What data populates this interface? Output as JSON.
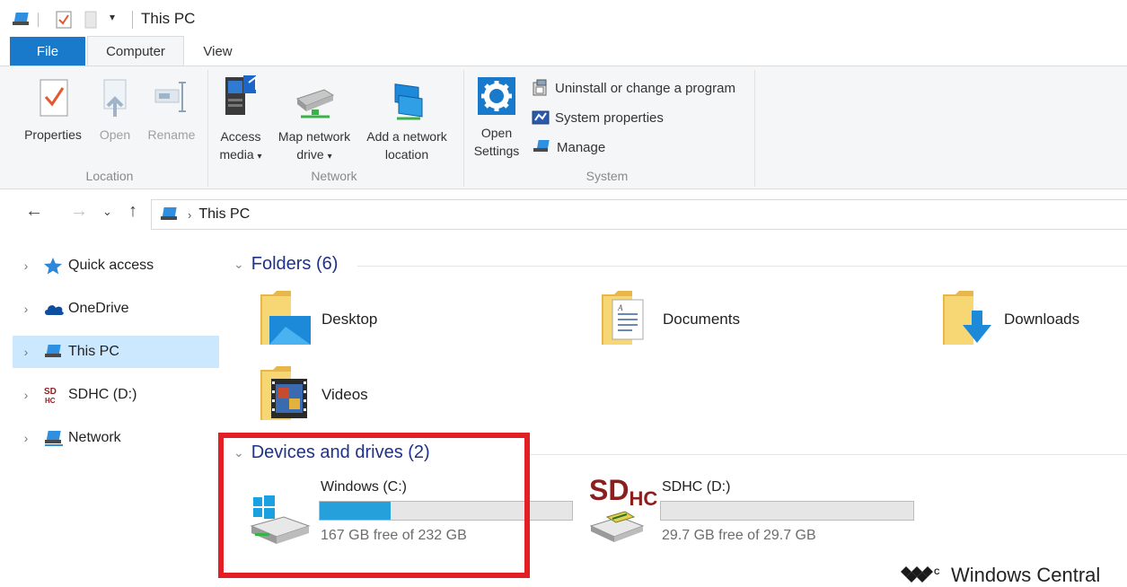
{
  "window": {
    "title": "This PC"
  },
  "tabs": [
    {
      "label": "File"
    },
    {
      "label": "Computer"
    },
    {
      "label": "View"
    }
  ],
  "ribbon": {
    "location": {
      "properties": "Properties",
      "open": "Open",
      "rename": "Rename",
      "group_label": "Location"
    },
    "network": {
      "access_media_line1": "Access",
      "access_media_line2": "media",
      "map_drive_line1": "Map network",
      "map_drive_line2": "drive",
      "add_location_line1": "Add a network",
      "add_location_line2": "location",
      "group_label": "Network"
    },
    "system": {
      "open_settings_line1": "Open",
      "open_settings_line2": "Settings",
      "uninstall": "Uninstall or change a program",
      "system_properties": "System properties",
      "manage": "Manage",
      "group_label": "System"
    }
  },
  "address_bar": {
    "path": "This PC"
  },
  "sidebar": {
    "items": [
      {
        "label": "Quick access",
        "icon": "star-icon"
      },
      {
        "label": "OneDrive",
        "icon": "cloud-icon"
      },
      {
        "label": "This PC",
        "icon": "computer-icon",
        "selected": true
      },
      {
        "label": "SDHC (D:)",
        "icon": "sd-card-icon"
      },
      {
        "label": "Network",
        "icon": "network-icon"
      }
    ]
  },
  "folders": {
    "header": "Folders (6)",
    "items": [
      {
        "name": "Desktop"
      },
      {
        "name": "Documents"
      },
      {
        "name": "Downloads"
      },
      {
        "name": "Videos"
      }
    ]
  },
  "drives": {
    "header": "Devices and drives (2)",
    "items": [
      {
        "name": "Windows (C:)",
        "free_text": "167 GB free of 232 GB",
        "used_fraction": 0.28
      },
      {
        "name": "SDHC (D:)",
        "free_text": "29.7 GB free of 29.7 GB",
        "used_fraction": 0.0,
        "logo": "SD",
        "logo_sub": "HC"
      }
    ]
  },
  "watermark": "Windows Central",
  "colors": {
    "accent": "#1979ca",
    "selection": "#cce8ff",
    "header": "#1e3287",
    "drive_bar": "#26a0da",
    "highlight": "#e31e24"
  }
}
